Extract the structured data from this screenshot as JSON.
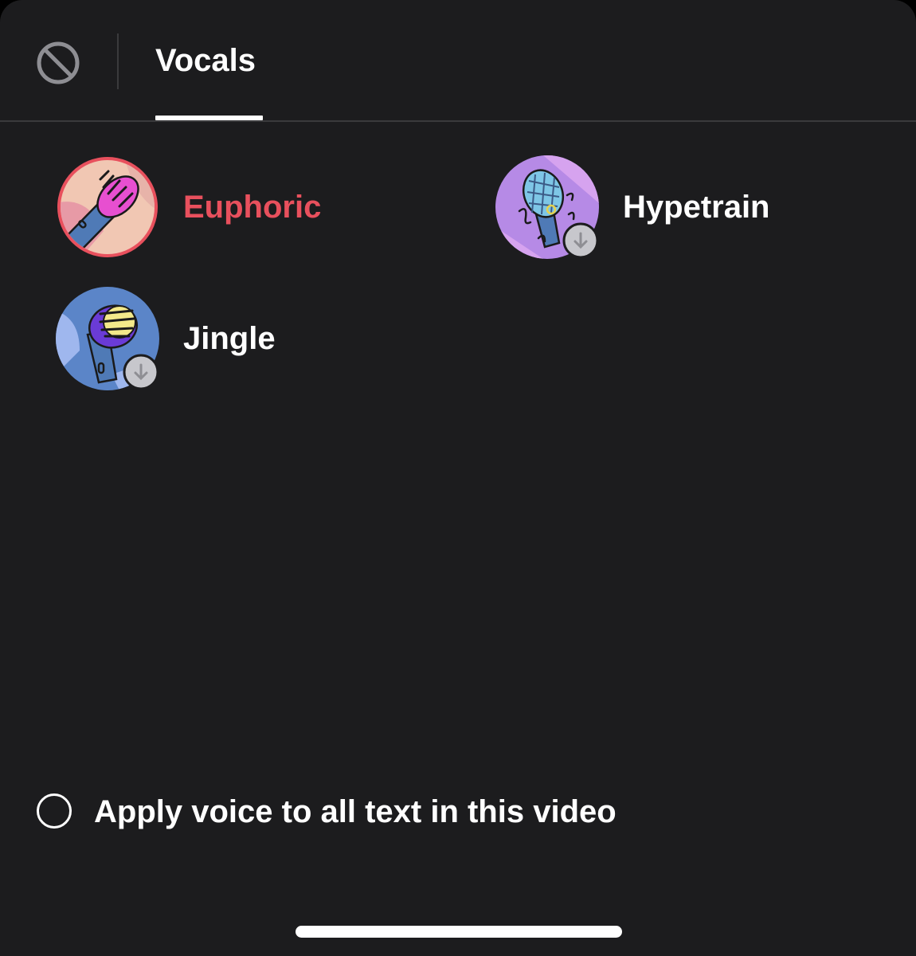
{
  "tabs": [
    {
      "label": "Vocals",
      "active": true
    }
  ],
  "voices": [
    {
      "name": "Euphoric",
      "selected": true,
      "downloaded": true,
      "icon": "microphone-pink-icon"
    },
    {
      "name": "Hypetrain",
      "selected": false,
      "downloaded": false,
      "icon": "microphone-purple-icon"
    },
    {
      "name": "Jingle",
      "selected": false,
      "downloaded": false,
      "icon": "microphone-yellow-icon"
    }
  ],
  "apply_all": {
    "label": "Apply voice to all text in this video",
    "checked": false
  },
  "colors": {
    "background": "#1c1c1e",
    "accent": "#e8505d",
    "text": "#ffffff"
  }
}
